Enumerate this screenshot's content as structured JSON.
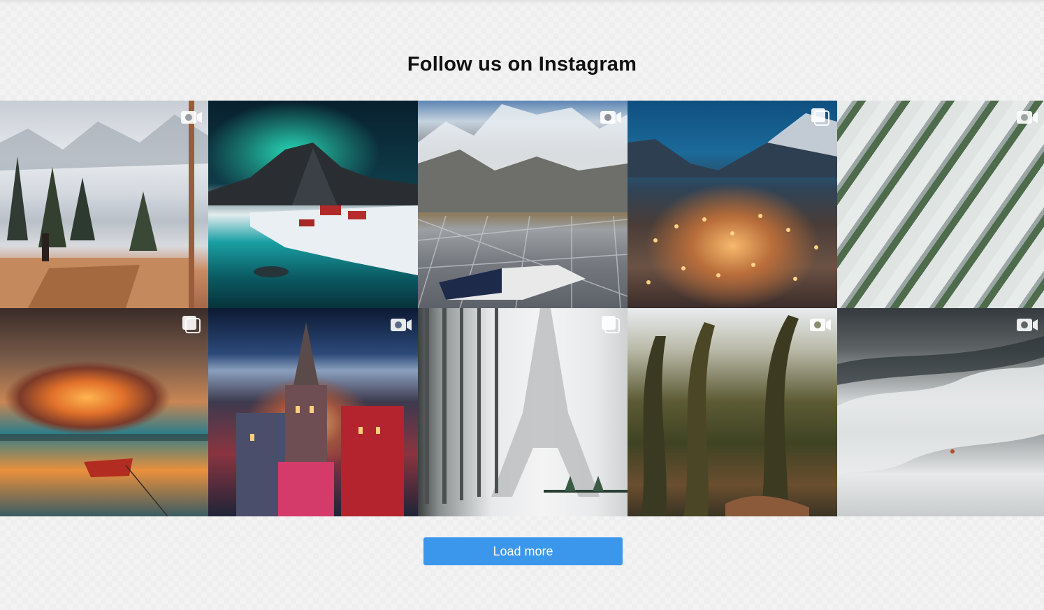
{
  "section": {
    "title": "Follow us on Instagram"
  },
  "feed": {
    "posts": [
      {
        "subject": "winter lake view from cabin window",
        "media_type": "video",
        "icon": "video-camera-icon"
      },
      {
        "subject": "northern lights over snowy fjord village",
        "media_type": "image",
        "icon": ""
      },
      {
        "subject": "person lying in net hammock above mountains",
        "media_type": "video",
        "icon": "video-camera-icon"
      },
      {
        "subject": "snowy mountain town at dusk",
        "media_type": "carousel",
        "icon": "carousel-icon"
      },
      {
        "subject": "aerial view of stacked white apartment blocks",
        "media_type": "video",
        "icon": "video-camera-icon"
      },
      {
        "subject": "swirling orange cloud over lake with boat",
        "media_type": "carousel",
        "icon": "carousel-icon"
      },
      {
        "subject": "illuminated castle at night above river",
        "media_type": "video",
        "icon": "video-camera-icon"
      },
      {
        "subject": "Eiffel Tower in snowy fog",
        "media_type": "carousel",
        "icon": "carousel-icon"
      },
      {
        "subject": "mossy old-growth forest",
        "media_type": "video",
        "icon": "video-camera-icon"
      },
      {
        "subject": "hiker on snowy forested hillside",
        "media_type": "video",
        "icon": "video-camera-icon"
      }
    ]
  },
  "actions": {
    "load_more_label": "Load more"
  },
  "colors": {
    "button_bg": "#3b97ec",
    "button_text": "#ffffff",
    "title_text": "#111111",
    "page_bg": "#f3f3f3"
  }
}
